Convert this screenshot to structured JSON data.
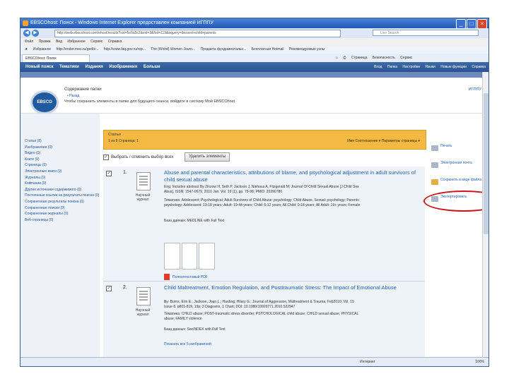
{
  "window": {
    "title": "EBSCOhost: Поиск - Windows Internet Explorer предоставлен компанией ИГППУ",
    "controls": [
      "_",
      "□",
      "×"
    ]
  },
  "address": {
    "url": "http://web.ebscohost.com/ehost/results?sid=5e5a5c2&vid=3&hid=113&bquery=dessert+child+parents",
    "search_placeholder": "Live Search"
  },
  "menu": [
    "Файл",
    "Правка",
    "Вид",
    "Избранное",
    "Сервис",
    "Справка"
  ],
  "favorites": [
    "Избранное",
    "http://ender.mos.ru/ged/e...",
    "http://www.faq.gov.ru/rep...",
    "The (Wolrd) Women Journ...",
    "Продакта фундаментальн...",
    "Бесплатная Hotmail",
    "Рекомендуемые узлы"
  ],
  "tab": {
    "label": "EBSCOhost: Поиск"
  },
  "commandbar": [
    "Страница",
    "Безопасность",
    "Сервис"
  ],
  "ebsco_nav": {
    "left": [
      "Новый поиск",
      "Тематики",
      "Издания",
      "Изображения",
      "Больше"
    ],
    "right": [
      "Вход",
      "Папка",
      "Настройки",
      "Языки",
      "Новые функции",
      "Справка"
    ]
  },
  "header": {
    "line1": "Содержание папки",
    "line2": "• Назад",
    "line3": "Чтобы сохранить элементы в папке для будущего сеанса, войдите в систему Мой EBSCOhost.",
    "lang": "ИГППУ",
    "logo": "EBSCO"
  },
  "left_panel": [
    "Статьи (8)",
    "Изображения (0)",
    "Видео (0)",
    "Книги (0)",
    "Страницы (0)",
    "Электронные книги (0)",
    "Журналы (0)",
    "Компании (0)",
    "Другие источники содержимого (0)",
    "Постоянные ссылки на результаты поиска (0)",
    "Сохраненные результаты поиска (0)",
    "Сохраненные поиски (0)",
    "Сохраненные журналы (0)",
    "Веб-страницы (0)"
  ],
  "results_header": {
    "title": "Статьи",
    "range": "1 из 8 Страница: 1",
    "sort": "Имя Соотношение   ▾   Параметры страницы ▾"
  },
  "select_bar": {
    "label": "Выбрать / отменить выбор всех",
    "remove_button": "Удалить элементы"
  },
  "records": [
    {
      "num": "1.",
      "type": "Научный журнал",
      "title": "Abuse and parental characteristics, attributions of blame, and psychological adjustment in adult survivors of child sexual abuse",
      "lines": [
        "Eng; Includes abstract By Zinzow H, Seth P, Jackson J, Niehaus A, Fitzgerald M; Journal Of Child Sexual Abuse [J Child Sex",
        "Abus], ISSN: 1547-0679, 2010 Jan; Vol. 19 (1), pp. 79-98; PMID: 20390780",
        "Тематика: Adolescent; Psychological; Adult Survivors of Child Abuse: psychology; Child Abuse, Sexual: psychology; Parents:",
        "psychology; Adolescent: 13-18 years; Adult: 19-44 years; Child: 6-12 years; All Child: 0-18 years; All Adult: 19+ years; Female"
      ],
      "db": "База данных: MEDLINE with Full Text",
      "pdf": "Полнотекстовый PDF"
    },
    {
      "num": "2.",
      "type": "Научный журнал",
      "title": "Child Maltreatment, Emotion Regulation, and Posttraumatic Stress: The Impact of Emotional Abuse",
      "lines": [
        "By: Burns, Erin E.; Jackson, Joan L.; Harding, Hilary G.; Journal of Aggression, Maltreatment & Trauma, Feb2010; Vol. 19",
        "Issue 8, p801-819, 19p; 3 Diagrams, 1 Chart; DOI: 10.1080/10926771.2010.522947",
        "Тематика: CHILD abuse; POST-traumatic stress disorder; PSYCHOLOGICAL child abuse; CHILD sexual abuse; PHYSICAL",
        "abuse; FAMILY violence"
      ],
      "db": "База данных: SocINDEX with Full Text",
      "more": "Показать все 5 изображений"
    }
  ],
  "right_panel": [
    "Печать",
    "Электронная почта",
    "Сохранить в виде файла",
    "Экспортировать"
  ],
  "status": {
    "zone": "Интернет",
    "zoom": "100%"
  }
}
